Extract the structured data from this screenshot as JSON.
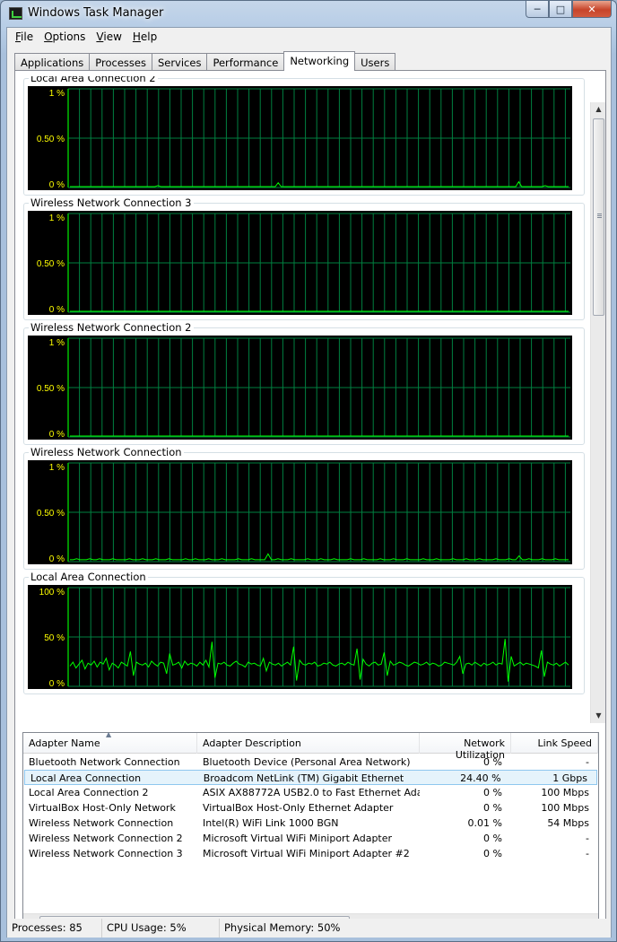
{
  "window": {
    "title": "Windows Task Manager"
  },
  "menu": [
    {
      "label": "File",
      "accel": "F",
      "rest": "ile"
    },
    {
      "label": "Options",
      "accel": "O",
      "rest": "ptions"
    },
    {
      "label": "View",
      "accel": "V",
      "rest": "iew"
    },
    {
      "label": "Help",
      "accel": "H",
      "rest": "elp"
    }
  ],
  "tabs": [
    "Applications",
    "Processes",
    "Services",
    "Performance",
    "Networking",
    "Users"
  ],
  "active_tab": "Networking",
  "graphs": [
    {
      "title": "Local Area Connection 2",
      "y_labels": [
        "1 %",
        "0.50 %",
        "0 %"
      ],
      "ylim": [
        0,
        1
      ],
      "values": [
        0,
        0,
        0,
        0,
        0,
        0,
        0,
        0,
        0,
        0,
        0,
        0,
        0,
        0,
        0,
        0,
        0,
        0,
        0,
        0,
        0,
        0,
        0,
        0,
        0,
        0,
        0,
        0,
        0,
        0,
        0.01,
        0,
        0,
        0,
        0,
        0,
        0,
        0,
        0,
        0,
        0,
        0,
        0,
        0,
        0,
        0,
        0,
        0,
        0,
        0,
        0,
        0,
        0,
        0,
        0,
        0,
        0,
        0,
        0,
        0,
        0,
        0,
        0,
        0,
        0,
        0,
        0,
        0,
        0,
        0,
        0,
        0.04,
        0,
        0,
        0,
        0,
        0,
        0,
        0,
        0,
        0,
        0,
        0,
        0,
        0,
        0,
        0,
        0,
        0,
        0,
        0,
        0,
        0,
        0,
        0,
        0,
        0,
        0,
        0,
        0,
        0,
        0,
        0,
        0,
        0,
        0,
        0,
        0,
        0,
        0,
        0,
        0,
        0,
        0,
        0,
        0,
        0,
        0,
        0,
        0,
        0,
        0,
        0,
        0,
        0,
        0,
        0,
        0,
        0,
        0,
        0,
        0,
        0,
        0,
        0,
        0,
        0,
        0,
        0,
        0,
        0,
        0,
        0,
        0,
        0,
        0,
        0,
        0,
        0,
        0,
        0,
        0,
        0,
        0.05,
        0,
        0,
        0,
        0,
        0,
        0,
        0,
        0,
        0.01,
        0,
        0,
        0,
        0,
        0,
        0,
        0,
        0
      ]
    },
    {
      "title": "Wireless Network Connection 3",
      "y_labels": [
        "1 %",
        "0.50 %",
        "0 %"
      ],
      "ylim": [
        0,
        1
      ],
      "values": [
        0,
        0
      ]
    },
    {
      "title": "Wireless Network Connection 2",
      "y_labels": [
        "1 %",
        "0.50 %",
        "0 %"
      ],
      "ylim": [
        0,
        1
      ],
      "values": [
        0,
        0
      ]
    },
    {
      "title": "Wireless Network Connection",
      "y_labels": [
        "1 %",
        "0.50 %",
        "0 %"
      ],
      "ylim": [
        0,
        1
      ],
      "values": [
        0.01,
        0.01,
        0.02,
        0.01,
        0.01,
        0.01,
        0.02,
        0.01,
        0.01,
        0.02,
        0.01,
        0.01,
        0.01,
        0.02,
        0.01,
        0.01,
        0.01,
        0.01,
        0.02,
        0.01,
        0.01,
        0.01,
        0.02,
        0.01,
        0.01,
        0.01,
        0.02,
        0.01,
        0.01,
        0.01,
        0.02,
        0.01,
        0.01,
        0.01,
        0.01,
        0.02,
        0.01,
        0.01,
        0.02,
        0.01,
        0.01,
        0.01,
        0.02,
        0.01,
        0.01,
        0.01,
        0.02,
        0.01,
        0.01,
        0.01,
        0.01,
        0.02,
        0.01,
        0.01,
        0.01,
        0.02,
        0.01,
        0.01,
        0.01,
        0.01,
        0.07,
        0.01,
        0.01,
        0.02,
        0.01,
        0.01,
        0.01,
        0.02,
        0.01,
        0.01,
        0.01,
        0.01,
        0.02,
        0.01,
        0.01,
        0.01,
        0.02,
        0.01,
        0.01,
        0.01,
        0.02,
        0.01,
        0.01,
        0.01,
        0.01,
        0.02,
        0.01,
        0.01,
        0.01,
        0.02,
        0.01,
        0.01,
        0.01,
        0.01,
        0.02,
        0.01,
        0.01,
        0.01,
        0.02,
        0.01,
        0.01,
        0.01,
        0.02,
        0.01,
        0.01,
        0.01,
        0.01,
        0.02,
        0.01,
        0.01,
        0.01,
        0.02,
        0.01,
        0.01,
        0.01,
        0.01,
        0.02,
        0.01,
        0.01,
        0.01,
        0.02,
        0.01,
        0.01,
        0.01,
        0.02,
        0.01,
        0.01,
        0.01,
        0.01,
        0.02,
        0.01,
        0.01,
        0.01,
        0.02,
        0.01,
        0.01,
        0.05,
        0.01,
        0.01,
        0.02,
        0.01,
        0.01,
        0.01,
        0.02,
        0.01,
        0.01,
        0.01,
        0.02,
        0.01,
        0.01,
        0.01,
        0.01
      ]
    },
    {
      "title": "Local Area Connection",
      "y_labels": [
        "100 %",
        "50 %",
        "0 %"
      ],
      "ylim": [
        0,
        100
      ],
      "values": [
        20,
        24,
        18,
        22,
        26,
        17,
        23,
        21,
        25,
        19,
        24,
        22,
        28,
        16,
        23,
        21,
        18,
        24,
        22,
        20,
        35,
        10,
        24,
        22,
        21,
        23,
        19,
        25,
        22,
        20,
        24,
        23,
        12,
        33,
        21,
        22,
        24,
        18,
        25,
        21,
        23,
        22,
        20,
        24,
        21,
        26,
        19,
        45,
        8,
        23,
        22,
        24,
        21,
        20,
        23,
        25,
        22,
        21,
        19,
        24,
        22,
        23,
        21,
        20,
        28,
        15,
        24,
        22,
        21,
        23,
        20,
        22,
        24,
        21,
        40,
        5,
        26,
        22,
        21,
        23,
        22,
        24,
        20,
        21,
        23,
        22,
        24,
        21,
        20,
        22,
        23,
        21,
        24,
        22,
        21,
        38,
        6,
        27,
        22,
        20,
        23,
        24,
        21,
        22,
        34,
        10,
        25,
        21,
        22,
        24,
        23,
        21,
        20,
        22,
        24,
        23,
        21,
        22,
        24,
        21,
        23,
        22,
        20,
        21,
        24,
        23,
        22,
        21,
        24,
        30,
        12,
        22,
        23,
        21,
        24,
        22,
        20,
        23,
        21,
        22,
        24,
        21,
        23,
        22,
        48,
        4,
        30,
        20,
        22,
        24,
        21,
        23,
        22,
        21,
        20,
        18,
        36,
        9,
        24,
        22,
        21,
        23,
        20,
        22,
        24,
        21
      ]
    }
  ],
  "adapter_list": {
    "columns": [
      "Adapter Name",
      "Adapter Description",
      "Network Utilization",
      "Link Speed"
    ],
    "rows": [
      {
        "name": "Bluetooth Network Connection",
        "description": "Bluetooth Device (Personal Area Network)",
        "utilization": "0 %",
        "speed": "-"
      },
      {
        "name": "Local Area Connection",
        "description": "Broadcom NetLink (TM) Gigabit Ethernet",
        "utilization": "24.40 %",
        "speed": "1 Gbps"
      },
      {
        "name": "Local Area Connection 2",
        "description": "ASIX AX88772A USB2.0 to Fast Ethernet Ada...",
        "utilization": "0 %",
        "speed": "100 Mbps"
      },
      {
        "name": "VirtualBox Host-Only Network",
        "description": "VirtualBox Host-Only Ethernet Adapter",
        "utilization": "0 %",
        "speed": "100 Mbps"
      },
      {
        "name": "Wireless Network Connection",
        "description": "Intel(R) WiFi Link 1000 BGN",
        "utilization": "0.01 %",
        "speed": "54 Mbps"
      },
      {
        "name": "Wireless Network Connection 2",
        "description": "Microsoft Virtual WiFi Miniport Adapter",
        "utilization": "0 %",
        "speed": "-"
      },
      {
        "name": "Wireless Network Connection 3",
        "description": "Microsoft Virtual WiFi Miniport Adapter #2",
        "utilization": "0 %",
        "speed": "-"
      }
    ],
    "selected_row": 1
  },
  "status": {
    "processes": "Processes: 85",
    "cpu": "CPU Usage: 5%",
    "memory": "Physical Memory: 50%"
  },
  "colors": {
    "grid": "#008040",
    "line": "#00ff00",
    "axis_text": "#ffff00",
    "graph_bg": "#000000"
  }
}
